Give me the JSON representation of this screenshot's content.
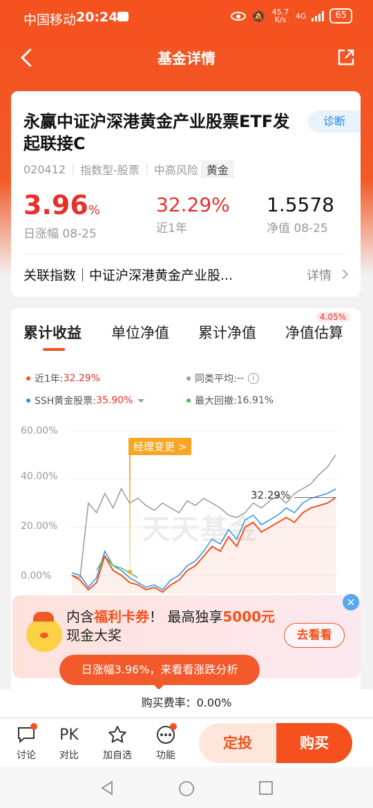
{
  "status_bar": {
    "carrier": "中国移动",
    "time": "20:24",
    "net_speed": "45.7 K/s",
    "network": "4G",
    "battery": "65"
  },
  "nav": {
    "title": "基金详情"
  },
  "fund": {
    "name": "永赢中证沪深港黄金产业股票ETF发起联接C",
    "diagnose_label": "诊断",
    "code": "020412",
    "category": "指数型-股票",
    "risk": "中高风险",
    "theme_tag": "黄金",
    "daily_change": "3.96",
    "daily_change_unit": "%",
    "daily_change_label": "日涨幅 08-25",
    "one_year_return": "32.29%",
    "one_year_label": "近1年",
    "nav_value": "1.5578",
    "nav_label": "净值 08-25",
    "index_row_label": "关联指数｜中证沪深港黄金产业股...",
    "index_row_detail": "详情"
  },
  "tabs": [
    {
      "label": "累计收益",
      "active": true
    },
    {
      "label": "单位净值"
    },
    {
      "label": "累计净值"
    },
    {
      "label": "净值估算",
      "badge": "4.05%"
    }
  ],
  "legend": {
    "fund": {
      "label": "近1年:",
      "value": "32.29%",
      "color": "#f4511e"
    },
    "peer": {
      "label": "同类平均:",
      "value": "--",
      "color": "#999999"
    },
    "index": {
      "label": "SSH黄金股票:",
      "value": "35.90%",
      "color": "#2f8fe8"
    },
    "drawdown": {
      "label": "最大回撤:",
      "value": "16.91%",
      "color": "#4cba4a"
    }
  },
  "chart_data": {
    "type": "line",
    "y_ticks": [
      "60.00%",
      "40.00%",
      "20.00%",
      "0.00%"
    ],
    "ylim": [
      -10,
      60
    ],
    "annotation_label": "32.29%",
    "manager_change_label": "经理变更 >",
    "watermark": "天天基金",
    "series": [
      {
        "name": "近1年",
        "color": "#f4511e",
        "values": [
          0,
          -2,
          -6,
          -3,
          8,
          2,
          0,
          -3,
          -4,
          -6,
          -5,
          -7,
          -4,
          -2,
          2,
          4,
          8,
          12,
          10,
          16,
          12,
          20,
          22,
          18,
          20,
          22,
          24,
          22,
          26,
          28,
          29,
          30,
          32.29
        ]
      },
      {
        "name": "SSH黄金股票",
        "color": "#2f8fe8",
        "values": [
          1,
          0,
          -5,
          -1,
          10,
          4,
          2,
          -1,
          -3,
          -5,
          -4,
          -6,
          -2,
          0,
          4,
          6,
          10,
          15,
          13,
          19,
          15,
          23,
          25,
          21,
          23,
          25,
          28,
          26,
          30,
          32,
          33,
          34,
          35.9
        ]
      },
      {
        "name": "同类平均",
        "color": "#999999",
        "values": [
          0,
          -1,
          30,
          26,
          34,
          28,
          36,
          30,
          32,
          29,
          27,
          30,
          28,
          26,
          31,
          29,
          32,
          30,
          28,
          25,
          24,
          26,
          30,
          28,
          31,
          33,
          30,
          34,
          36,
          38,
          42,
          45,
          50
        ]
      },
      {
        "name": "最大回撤",
        "color": "#4cba4a",
        "values": [
          null,
          null,
          null,
          2,
          8,
          4,
          3,
          1,
          -1,
          null,
          null,
          null,
          null,
          null,
          null,
          null,
          null,
          null,
          null,
          null,
          null,
          null,
          null,
          null,
          null,
          null,
          null,
          null,
          null,
          null,
          null,
          null,
          null
        ]
      }
    ]
  },
  "promo": {
    "text_pre": "内含",
    "text_hl1": "福利卡券",
    "text_mid": "！ 最高独享",
    "text_hl2": "5000元",
    "text_post": "现金大奖",
    "cta": "去看看",
    "close": "×"
  },
  "daily_tip": "日涨幅3.96%，来看看涨跌分析",
  "fee_text": "购买费率：0.00%",
  "bottom_nav": [
    {
      "label": "讨论"
    },
    {
      "label": "对比",
      "icon_text": "PK"
    },
    {
      "label": "加自选"
    },
    {
      "label": "功能"
    }
  ],
  "actions": {
    "sip": "定投",
    "buy": "购买"
  }
}
